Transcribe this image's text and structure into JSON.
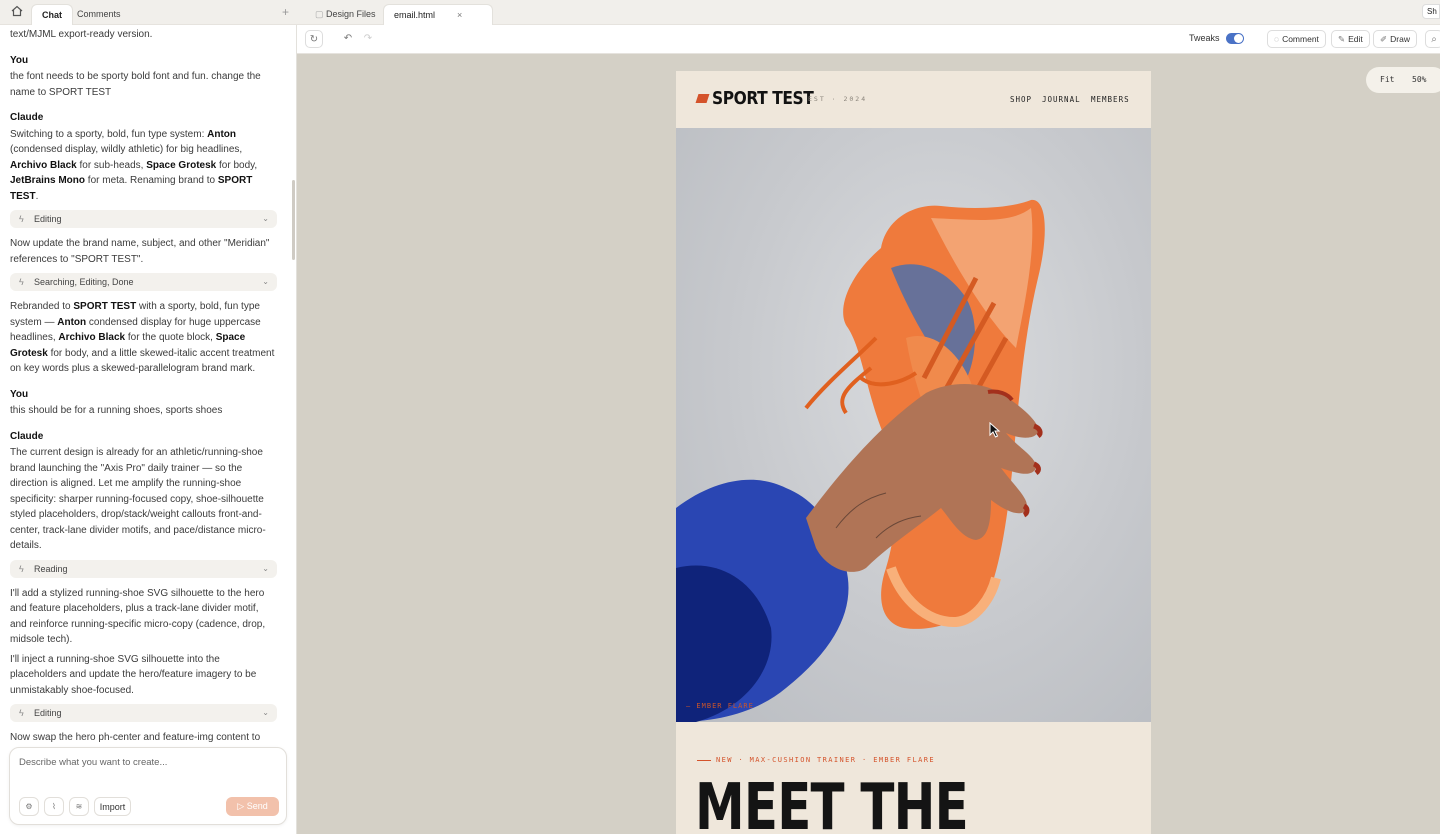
{
  "left_tabs": {
    "home": "home",
    "chat": "Chat",
    "comments": "Comments",
    "add": "+"
  },
  "chat": {
    "top_fragment": "text/MJML export-ready version.",
    "messages": [
      {
        "who": "You",
        "text": "the font needs to be sporty bold font and fun. change the name to SPORT TEST"
      },
      {
        "who": "Claude"
      }
    ],
    "claude1": {
      "a": "Switching to a sporty, bold, fun type system: ",
      "b1": "Anton",
      "c": " (condensed display, wildly athletic) for big headlines, ",
      "b2": "Archivo Black",
      "d": " for sub-heads, ",
      "b3": "Space Grotesk",
      "e": " for body, ",
      "b4": "JetBrains Mono",
      "f": " for meta. Renaming brand to ",
      "b5": "SPORT TEST",
      "g": "."
    },
    "tool1": "Editing",
    "claude2": "Now update the brand name, subject, and other \"Meridian\" references to \"SPORT TEST\".",
    "tool2": "Searching, Editing, Done",
    "claude3": {
      "a": "Rebranded to ",
      "b1": "SPORT TEST",
      "c": " with a sporty, bold, fun type system — ",
      "b2": "Anton",
      "d": " condensed display for huge uppercase headlines, ",
      "b3": "Archivo Black",
      "e": " for the quote block, ",
      "b4": "Space Grotesk",
      "f": " for body, and a little skewed-italic accent treatment on key words plus a skewed-parallelogram brand mark."
    },
    "you2_who": "You",
    "you2": "this should be for a running shoes, sports shoes",
    "claude4_who": "Claude",
    "claude4": "The current design is already for an athletic/running-shoe brand launching the \"Axis Pro\" daily trainer — so the direction is aligned. Let me amplify the running-shoe specificity: sharper running-focused copy, shoe-silhouette styled placeholders, drop/stack/weight callouts front-and-center, track-lane divider motifs, and pace/distance micro-details.",
    "tool3": "Reading",
    "claude5": "I'll add a stylized running-shoe SVG silhouette to the hero and feature placeholders, plus a track-lane divider motif, and reinforce running-specific micro-copy (cadence, drop, midsole tech).",
    "claude6": "I'll inject a running-shoe SVG silhouette into the placeholders and update the hero/feature imagery to be unmistakably shoe-focused.",
    "tool4": "Editing",
    "claude7": "Now swap the hero ph-center and feature-img content to include a shoe silhouette SVG plus add a running-themed"
  },
  "composer": {
    "placeholder": "Describe what you want to create...",
    "import": "Import",
    "send": "Send"
  },
  "right_tabs": {
    "design_files": "Design Files",
    "file": "email.html",
    "close": "×",
    "share": "Sh"
  },
  "toolbar": {
    "tweaks": "Tweaks",
    "comment": "Comment",
    "edit": "Edit",
    "draw": "Draw"
  },
  "zoom": {
    "fit": "Fit",
    "level": "50%"
  },
  "email": {
    "brand": "SPORT TEST",
    "est": "EST · 2024",
    "nav": [
      "SHOP",
      "JOURNAL",
      "MEMBERS"
    ],
    "hero_caption": "— EMBER FLARE",
    "eyebrow": "NEW · MAX-CUSHION TRAINER · EMBER FLARE",
    "headline": "MEET THE"
  },
  "colors": {
    "accent": "#d4532b",
    "toggle": "#4a72c6",
    "canvas": "#d4d0c6",
    "email_bg": "#efe7db"
  }
}
